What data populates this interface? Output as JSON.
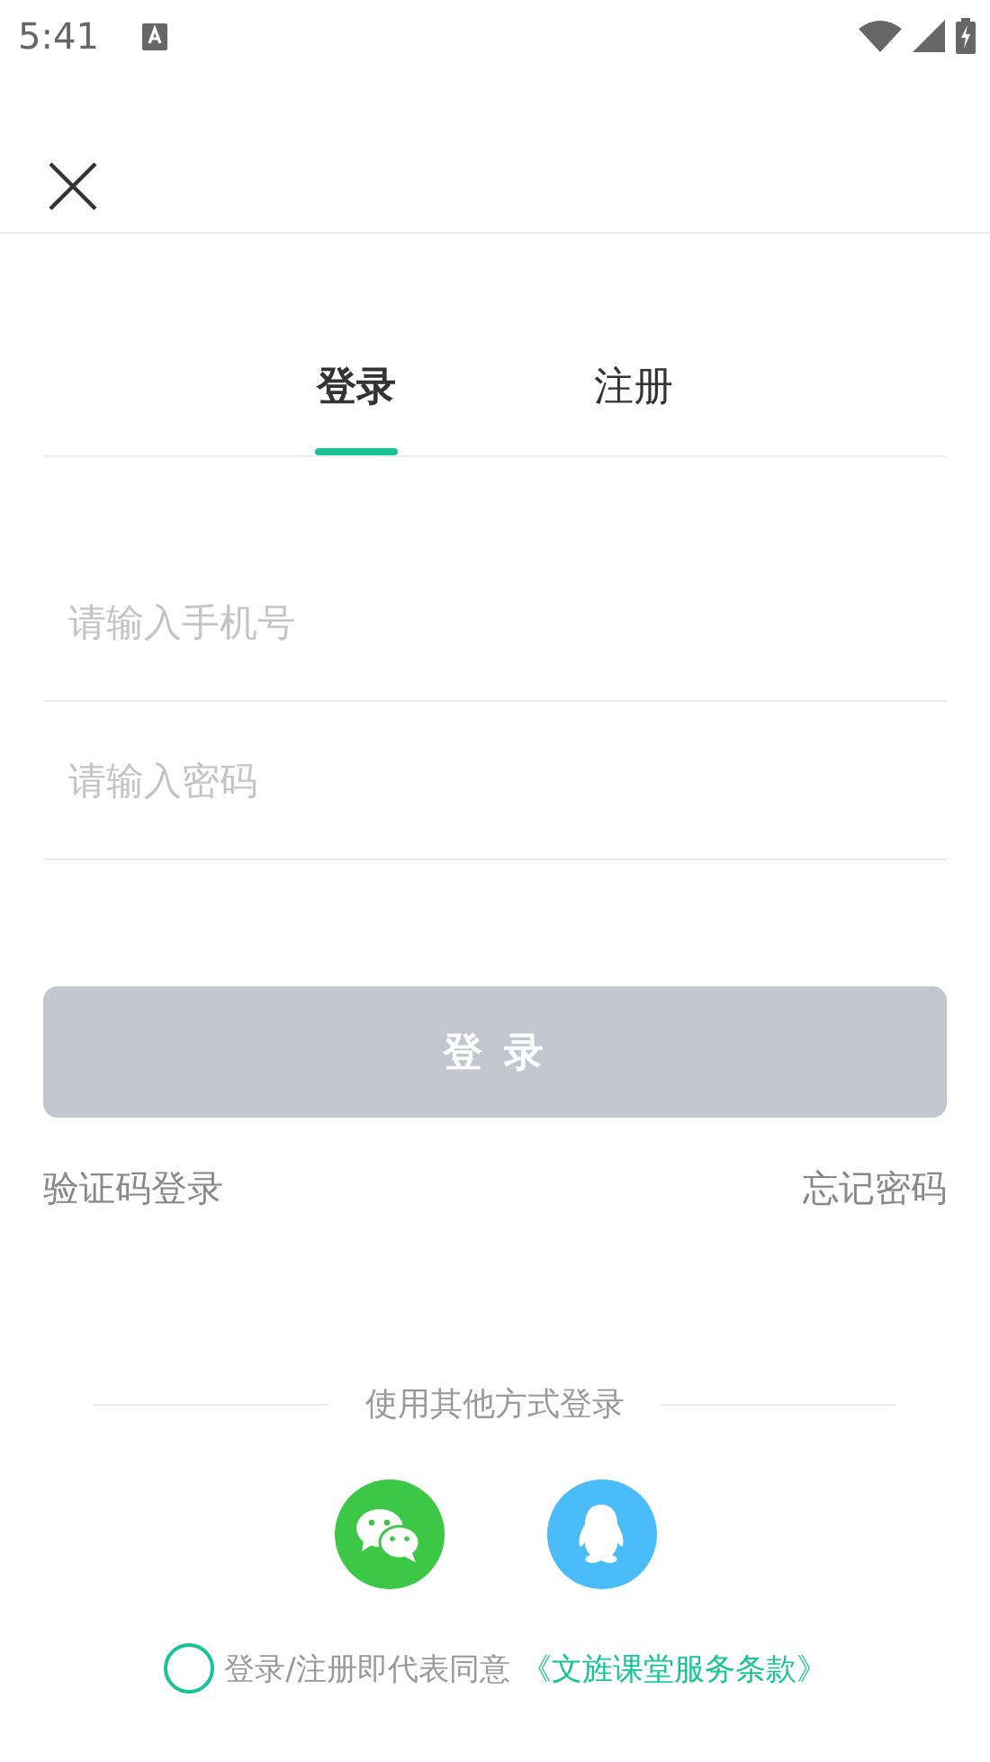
{
  "status_bar": {
    "time": "5:41"
  },
  "tabs": [
    {
      "label": "登录",
      "selected": true
    },
    {
      "label": "注册",
      "selected": false
    }
  ],
  "fields": [
    {
      "placeholder": "请输入手机号"
    },
    {
      "placeholder": "请输入密码"
    }
  ],
  "login_button": {
    "label": "登 录",
    "disabled": true
  },
  "links": {
    "sms_login": "验证码登录",
    "forgot_password": "忘记密码"
  },
  "other_login": {
    "title": "使用其他方式登录",
    "methods": [
      {
        "kind": "wechat",
        "color": "#3cc846"
      },
      {
        "kind": "qq",
        "color": "#4bbcfa"
      }
    ]
  },
  "agreement": {
    "checked": false,
    "text": "登录/注册即代表同意",
    "link": "《文旌课堂服务条款》"
  }
}
